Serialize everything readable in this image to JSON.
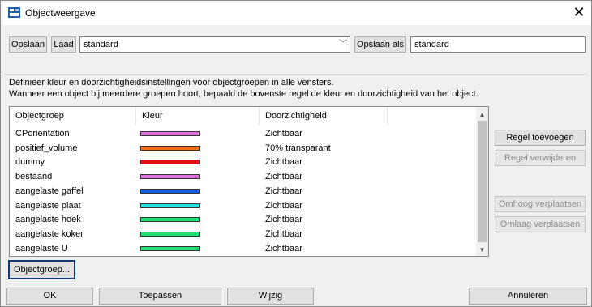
{
  "window": {
    "title": "Objectweergave",
    "close_glyph": "✕"
  },
  "toolbar": {
    "save_label": "Opslaan",
    "load_label": "Laad",
    "preset_value": "standard",
    "combo_arrow": "﹀",
    "save_as_label": "Opslaan als",
    "save_as_value": "standard"
  },
  "description": {
    "line1": "Definieer kleur en doorzichtigheidsinstellingen voor objectgroepen in alle vensters.",
    "line2": "Wanneer een object bij meerdere groepen hoort, bepaald de bovenste regel de kleur en doorzichtigheid van het object."
  },
  "table": {
    "columns": [
      "Objectgroep",
      "Kleur",
      "Doorzichtigheid"
    ],
    "rows": [
      {
        "group": "CPorientation",
        "color": "#e070e0",
        "transparency": "Zichtbaar"
      },
      {
        "group": "positief_volume",
        "color": "#f07020",
        "transparency": "70% transparant"
      },
      {
        "group": "dummy",
        "color": "#e01010",
        "transparency": "Zichtbaar"
      },
      {
        "group": "bestaand",
        "color": "#e070e0",
        "transparency": "Zichtbaar"
      },
      {
        "group": "aangelaste gaffel",
        "color": "#1060e0",
        "transparency": "Zichtbaar"
      },
      {
        "group": "aangelaste plaat",
        "color": "#20e0e0",
        "transparency": "Zichtbaar"
      },
      {
        "group": "aangelaste hoek",
        "color": "#20e070",
        "transparency": "Zichtbaar"
      },
      {
        "group": "aangelaste koker",
        "color": "#20e070",
        "transparency": "Zichtbaar"
      },
      {
        "group": "aangelaste U",
        "color": "#20e070",
        "transparency": "Zichtbaar"
      }
    ],
    "scroll_up": "▲",
    "scroll_down": "▼"
  },
  "side_buttons": {
    "add_rule": "Regel toevoegen",
    "remove_rule": "Regel verwijderen",
    "move_up": "Omhoog verplaatsen",
    "move_down": "Omlaag verplaatsen"
  },
  "objectgroup_button": "Objectgroep...",
  "footer": {
    "ok": "OK",
    "apply": "Toepassen",
    "modify": "Wijzig",
    "cancel": "Annuleren"
  }
}
